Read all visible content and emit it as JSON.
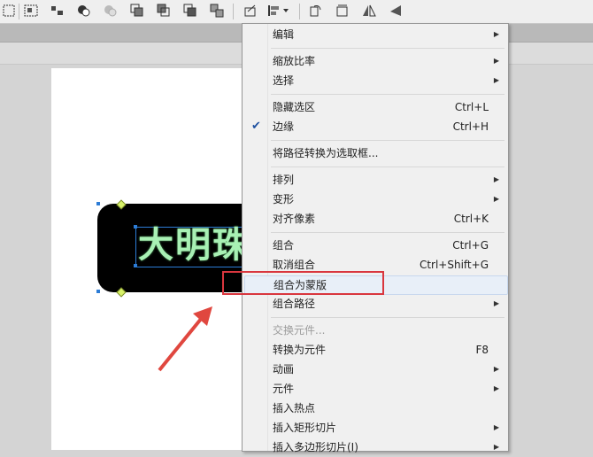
{
  "colors": {
    "accent_red": "#d9363e",
    "shape_fill": "#000000",
    "text_fill": "#a8f0b4",
    "check": "#1e50a0"
  },
  "toolbar": {
    "icons": [
      "select-icon",
      "group-icon",
      "union-icon",
      "intersect-icon",
      "punch-icon",
      "crop-icon",
      "bring-forward-icon",
      "send-backward-icon",
      "combine-icon",
      "transform-icon",
      "align-icon",
      "rotate-icon",
      "flip-horizontal-icon",
      "flip-vertical-icon",
      "flip-icon"
    ]
  },
  "canvas": {
    "shape_text": "大明珠"
  },
  "menu": {
    "items": [
      {
        "label": "编辑",
        "shortcut": "",
        "submenu": true
      },
      {
        "label": "缩放比率",
        "shortcut": "",
        "submenu": true
      },
      {
        "label": "选择",
        "shortcut": "",
        "submenu": true
      },
      {
        "label": "隐藏选区",
        "shortcut": "Ctrl+L"
      },
      {
        "label": "边缘",
        "shortcut": "Ctrl+H",
        "checked": true
      },
      {
        "label": "将路径转换为选取框...",
        "shortcut": ""
      },
      {
        "label": "排列",
        "shortcut": "",
        "submenu": true
      },
      {
        "label": "变形",
        "shortcut": "",
        "submenu": true
      },
      {
        "label": "对齐像素",
        "shortcut": "Ctrl+K"
      },
      {
        "label": "组合",
        "shortcut": "Ctrl+G"
      },
      {
        "label": "取消组合",
        "shortcut": "Ctrl+Shift+G"
      },
      {
        "label": "组合为蒙版",
        "shortcut": ""
      },
      {
        "label": "组合路径",
        "shortcut": "",
        "submenu": true
      },
      {
        "label": "交换元件...",
        "shortcut": "",
        "disabled": true
      },
      {
        "label": "转换为元件",
        "shortcut": "F8"
      },
      {
        "label": "动画",
        "shortcut": "",
        "submenu": true
      },
      {
        "label": "元件",
        "shortcut": "",
        "submenu": true
      },
      {
        "label": "插入热点",
        "shortcut": ""
      },
      {
        "label": "插入矩形切片",
        "shortcut": "",
        "submenu": true
      },
      {
        "label": "插入多边形切片(I)",
        "shortcut": "",
        "submenu": true
      }
    ]
  }
}
